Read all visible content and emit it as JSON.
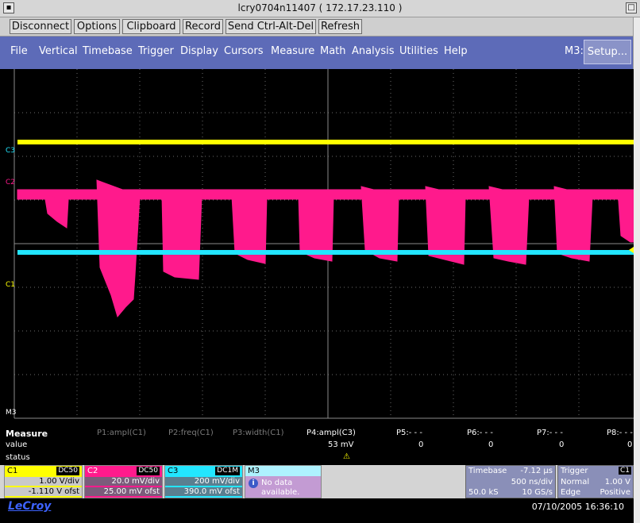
{
  "window": {
    "title": "lcry0704n11407 ( 172.17.23.110 )"
  },
  "vnc_toolbar": [
    "Disconnect",
    "Options",
    "Clipboard",
    "Record",
    "Send Ctrl-Alt-Del",
    "Refresh"
  ],
  "menu": [
    "File",
    "Vertical",
    "Timebase",
    "Trigger",
    "Display",
    "Cursors",
    "Measure",
    "Math",
    "Analysis",
    "Utilities",
    "Help"
  ],
  "m3_label": "M3:",
  "setup_label": "Setup...",
  "markers": {
    "c3": "C3",
    "c2": "C2",
    "c1": "C1",
    "m3": "M3"
  },
  "measure": {
    "title": "Measure",
    "row_value": "value",
    "row_status": "status",
    "params": [
      "P1:ampl(C1)",
      "P2:freq(C1)",
      "P3:width(C1)",
      "P4:ampl(C3)",
      "P5:- - -",
      "P6:- - -",
      "P7:- - -",
      "P8:- - -"
    ],
    "values": [
      "",
      "",
      "",
      "53 mV",
      "0",
      "0",
      "0",
      "0"
    ],
    "p4_status": "⚠"
  },
  "channels": {
    "c1": {
      "name": "C1",
      "coupling": "DC50",
      "vdiv": "1.00 V/div",
      "ofst": "-1.110 V ofst",
      "color": "#ffff00"
    },
    "c2": {
      "name": "C2",
      "coupling": "DC50",
      "vdiv": "20.0 mV/div",
      "ofst": "25.00 mV ofst",
      "color": "#ff1a8c"
    },
    "c3": {
      "name": "C3",
      "coupling": "DC1M",
      "vdiv": "200 mV/div",
      "ofst": "390.0 mV ofst",
      "color": "#22e6ff"
    },
    "m3": {
      "name": "M3",
      "line1": "No data",
      "line2": "available."
    }
  },
  "timebase": {
    "label": "Timebase",
    "delay": "-7.12 µs",
    "tdiv": "500 ns/div",
    "samples": "50.0 kS",
    "rate": "10 GS/s"
  },
  "trigger": {
    "label": "Trigger",
    "channel": "C1",
    "mode": "Normal",
    "level": "1.00 V",
    "type": "Edge",
    "slope": "Positive"
  },
  "brand": "LeCroy",
  "datetime": "07/10/2005 16:36:10",
  "colors": {
    "menu_bg": "#5d6bb8",
    "trace_c1": "#ffff00",
    "trace_c2": "#ff1a8c",
    "trace_c3": "#22e6ff"
  }
}
